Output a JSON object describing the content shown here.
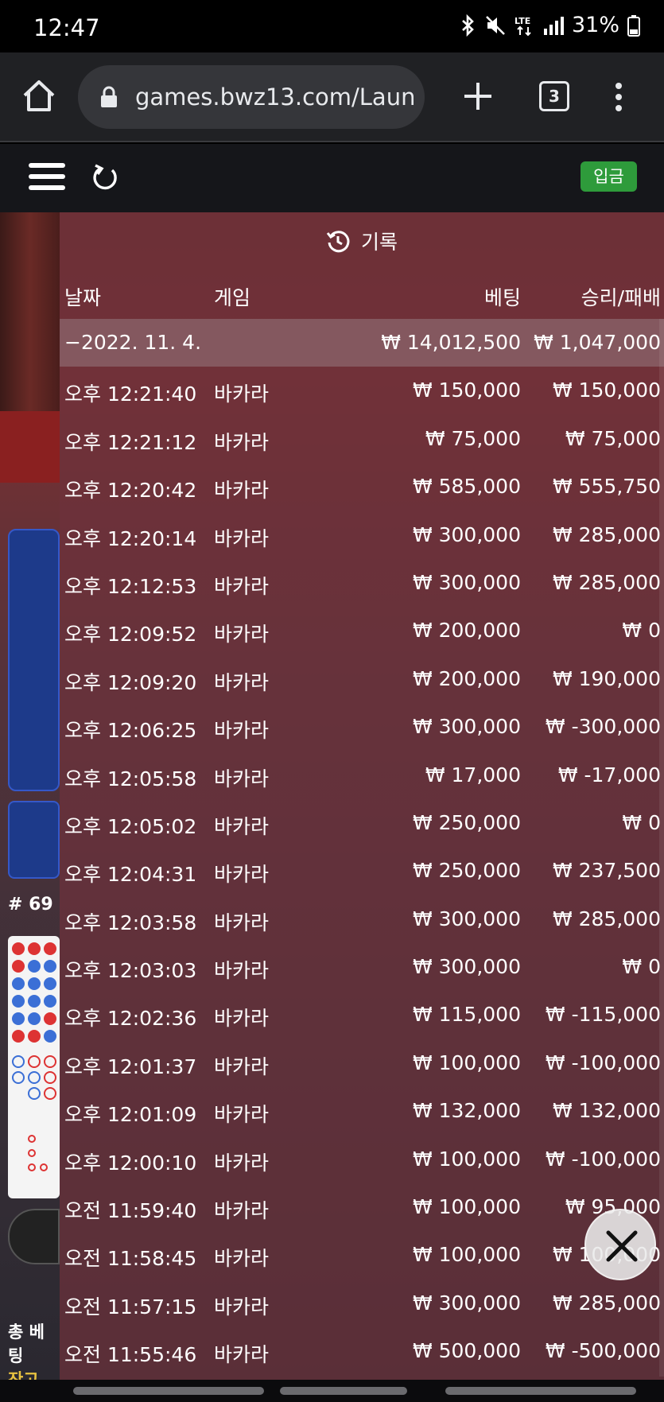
{
  "status_bar": {
    "time": "12:47",
    "battery": "31%",
    "icons": [
      "bluetooth-icon",
      "mute-icon",
      "lte-icon",
      "signal-icon",
      "battery-icon"
    ]
  },
  "browser": {
    "url": "games.bwz13.com/Laun",
    "tab_count": "3"
  },
  "game_header": {
    "deposit_label": "입금"
  },
  "background": {
    "round_label": "# 69",
    "total_bet_label": "총 베팅",
    "balance_label": "잔고 ₩"
  },
  "history": {
    "title": "기록",
    "columns": {
      "date": "날짜",
      "game": "게임",
      "bet": "베팅",
      "result": "승리/패배"
    },
    "summary": {
      "date": "−2022. 11. 4.",
      "bet": "₩ 14,012,500",
      "result": "₩ 1,047,000"
    },
    "rows": [
      {
        "time": "오후 12:21:40",
        "game": "바카라",
        "bet": "₩ 150,000",
        "result": "₩ 150,000"
      },
      {
        "time": "오후 12:21:12",
        "game": "바카라",
        "bet": "₩ 75,000",
        "result": "₩ 75,000"
      },
      {
        "time": "오후 12:20:42",
        "game": "바카라",
        "bet": "₩ 585,000",
        "result": "₩ 555,750"
      },
      {
        "time": "오후 12:20:14",
        "game": "바카라",
        "bet": "₩ 300,000",
        "result": "₩ 285,000"
      },
      {
        "time": "오후 12:12:53",
        "game": "바카라",
        "bet": "₩ 300,000",
        "result": "₩ 285,000"
      },
      {
        "time": "오후 12:09:52",
        "game": "바카라",
        "bet": "₩ 200,000",
        "result": "₩ 0"
      },
      {
        "time": "오후 12:09:20",
        "game": "바카라",
        "bet": "₩ 200,000",
        "result": "₩ 190,000"
      },
      {
        "time": "오후 12:06:25",
        "game": "바카라",
        "bet": "₩ 300,000",
        "result": "₩ -300,000"
      },
      {
        "time": "오후 12:05:58",
        "game": "바카라",
        "bet": "₩ 17,000",
        "result": "₩ -17,000"
      },
      {
        "time": "오후 12:05:02",
        "game": "바카라",
        "bet": "₩ 250,000",
        "result": "₩ 0"
      },
      {
        "time": "오후 12:04:31",
        "game": "바카라",
        "bet": "₩ 250,000",
        "result": "₩ 237,500"
      },
      {
        "time": "오후 12:03:58",
        "game": "바카라",
        "bet": "₩ 300,000",
        "result": "₩ 285,000"
      },
      {
        "time": "오후 12:03:03",
        "game": "바카라",
        "bet": "₩ 300,000",
        "result": "₩ 0"
      },
      {
        "time": "오후 12:02:36",
        "game": "바카라",
        "bet": "₩ 115,000",
        "result": "₩ -115,000"
      },
      {
        "time": "오후 12:01:37",
        "game": "바카라",
        "bet": "₩ 100,000",
        "result": "₩ -100,000"
      },
      {
        "time": "오후 12:01:09",
        "game": "바카라",
        "bet": "₩ 132,000",
        "result": "₩ 132,000"
      },
      {
        "time": "오후 12:00:10",
        "game": "바카라",
        "bet": "₩ 100,000",
        "result": "₩ -100,000"
      },
      {
        "time": "오전 11:59:40",
        "game": "바카라",
        "bet": "₩ 100,000",
        "result": "₩ 95,000"
      },
      {
        "time": "오전 11:58:45",
        "game": "바카라",
        "bet": "₩ 100,000",
        "result": "₩ 100,000"
      },
      {
        "time": "오전 11:57:15",
        "game": "바카라",
        "bet": "₩ 300,000",
        "result": "₩ 285,000"
      },
      {
        "time": "오전 11:55:46",
        "game": "바카라",
        "bet": "₩ 500,000",
        "result": "₩ -500,000"
      }
    ]
  },
  "colors": {
    "deposit_green": "#2e9b3b",
    "panel_tint": "#6e323c",
    "browser_bg": "#202124"
  }
}
